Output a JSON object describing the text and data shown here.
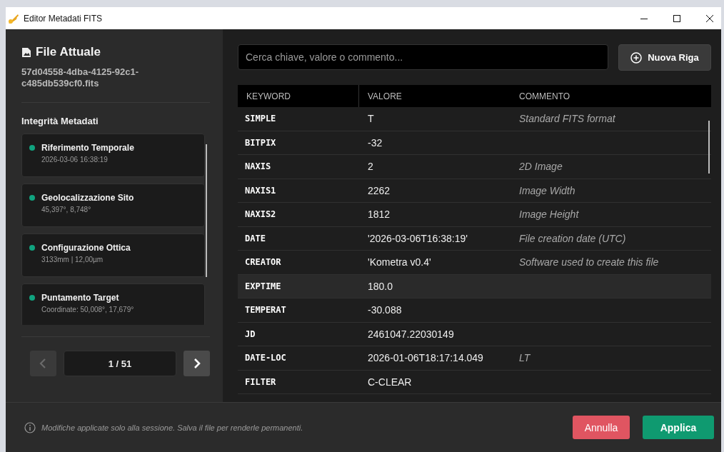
{
  "window": {
    "title": "Editor Metadati FITS"
  },
  "sidebar": {
    "heading": "File Attuale",
    "filename": "57d04558-4dba-4125-92c1-c485db539cf0.fits",
    "section_title": "Integrità Metadati",
    "checks": [
      {
        "title": "Riferimento Temporale",
        "detail": "2026-03-06 16:38:19",
        "color": "#10a37f"
      },
      {
        "title": "Geolocalizzazione Sito",
        "detail": "45,397°, 8,748°",
        "color": "#10a37f"
      },
      {
        "title": "Configurazione Ottica",
        "detail": "3133mm | 12,00µm",
        "color": "#10a37f"
      },
      {
        "title": "Puntamento Target",
        "detail": "Coordinate: 50,008°, 17,679°",
        "color": "#10a37f"
      }
    ],
    "pager": {
      "label": "1 / 51",
      "prev_disabled": true,
      "next_disabled": false
    }
  },
  "search": {
    "placeholder": "Cerca chiave, valore o commento..."
  },
  "new_row_button": "Nuova Riga",
  "table": {
    "columns": [
      "KEYWORD",
      "VALORE",
      "COMMENTO"
    ],
    "rows": [
      {
        "keyword": "SIMPLE",
        "value": "T",
        "comment": "Standard FITS format",
        "highlighted": false
      },
      {
        "keyword": "BITPIX",
        "value": "-32",
        "comment": "",
        "highlighted": false
      },
      {
        "keyword": "NAXIS",
        "value": "2",
        "comment": "2D Image",
        "highlighted": false
      },
      {
        "keyword": "NAXIS1",
        "value": "2262",
        "comment": "Image Width",
        "highlighted": false
      },
      {
        "keyword": "NAXIS2",
        "value": "1812",
        "comment": "Image Height",
        "highlighted": false
      },
      {
        "keyword": "DATE",
        "value": "'2026-03-06T16:38:19'",
        "comment": "File creation date (UTC)",
        "highlighted": false
      },
      {
        "keyword": "CREATOR",
        "value": "'Kometra v0.4'",
        "comment": "Software used to create this file",
        "highlighted": false
      },
      {
        "keyword": "EXPTIME",
        "value": "180.0",
        "comment": "",
        "highlighted": true
      },
      {
        "keyword": "TEMPERAT",
        "value": "-30.088",
        "comment": "",
        "highlighted": false
      },
      {
        "keyword": "JD",
        "value": "2461047.22030149",
        "comment": "",
        "highlighted": false
      },
      {
        "keyword": "DATE-LOC",
        "value": "2026-01-06T18:17:14.049",
        "comment": "LT",
        "highlighted": false
      },
      {
        "keyword": "FILTER",
        "value": "C-CLEAR",
        "comment": "",
        "highlighted": false
      }
    ]
  },
  "footer": {
    "note": "Modifiche applicate solo alla sessione. Salva il file per renderle permanenti.",
    "cancel_button": "Annulla",
    "apply_button": "Applica"
  }
}
